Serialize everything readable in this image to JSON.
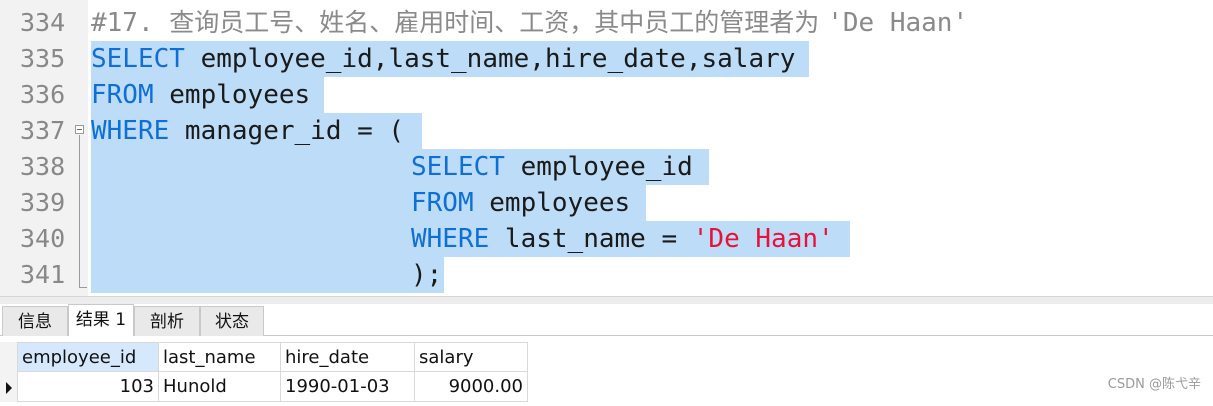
{
  "editor": {
    "lines": [
      {
        "number": "334",
        "comment_prefix": "#17. ",
        "comment_text": "查询员工号、姓名、雇用时间、工资，其中员工的管理者为 ",
        "comment_suffix": "'De Haan'"
      },
      {
        "number": "335",
        "keyword": "SELECT",
        "rest": " employee_id,last_name,hire_date,salary"
      },
      {
        "number": "336",
        "keyword": "FROM",
        "rest": " employees"
      },
      {
        "number": "337",
        "keyword": "WHERE",
        "rest": " manager_id = ("
      },
      {
        "number": "338",
        "keyword": "SELECT",
        "rest": " employee_id"
      },
      {
        "number": "339",
        "keyword": "FROM",
        "rest": " employees"
      },
      {
        "number": "340",
        "keyword": "WHERE",
        "rest": " last_name = ",
        "string": "'De Haan'"
      },
      {
        "number": "341",
        "rest": ");"
      }
    ]
  },
  "tabs": [
    {
      "label": "信息"
    },
    {
      "label": "结果 1"
    },
    {
      "label": "剖析"
    },
    {
      "label": "状态"
    }
  ],
  "results": {
    "columns": [
      "employee_id",
      "last_name",
      "hire_date",
      "salary"
    ],
    "rows": [
      [
        "103",
        "Hunold",
        "1990-01-03",
        "9000.00"
      ]
    ]
  },
  "watermark": "CSDN @陈弋辛",
  "colors": {
    "keyword": "#0f6fd6",
    "string": "#e8113a",
    "selection": "#bcdcf7",
    "comment": "#8a8a8a"
  }
}
